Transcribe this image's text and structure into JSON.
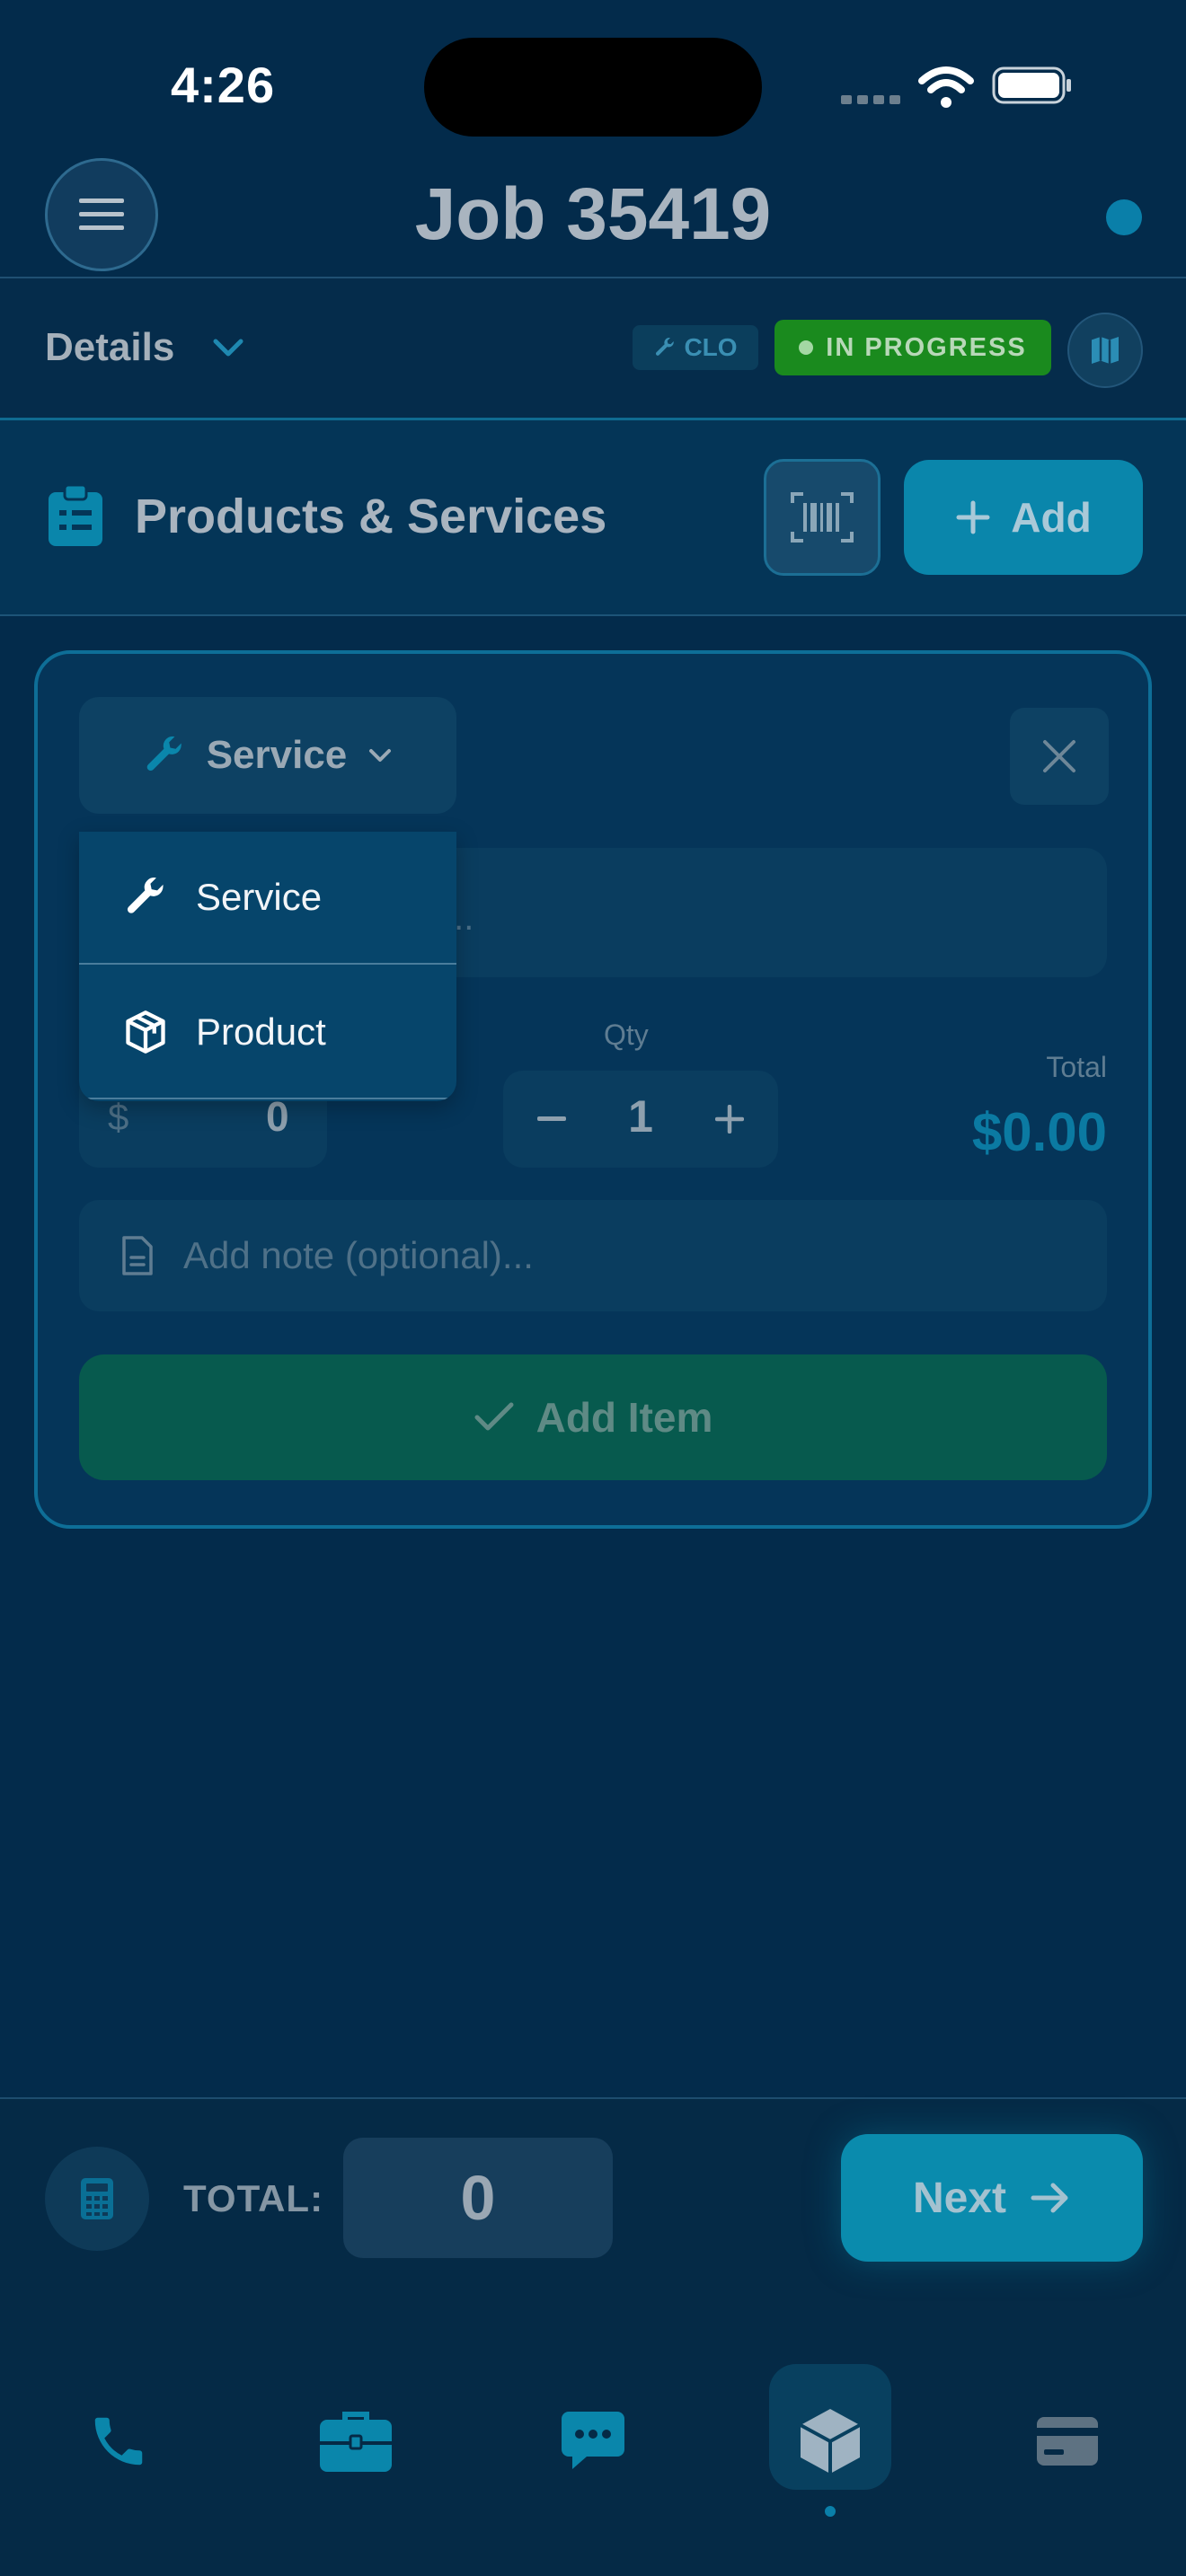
{
  "status_bar": {
    "time": "4:26"
  },
  "header": {
    "title": "Job 35419"
  },
  "details_bar": {
    "label": "Details",
    "trade_badge": "CLO",
    "status_badge": "IN PROGRESS"
  },
  "section": {
    "title": "Products & Services",
    "add_label": "Add"
  },
  "item_form": {
    "type_selected": "Service",
    "name_placeholder_tail": "...",
    "price_currency": "$",
    "price_value": "0",
    "qty_label": "Qty",
    "qty_value": "1",
    "total_label": "Total",
    "total_value": "$0.00",
    "note_placeholder": "Add note (optional)...",
    "add_item_label": "Add Item"
  },
  "dropdown": {
    "options": [
      {
        "label": "Service",
        "icon": "wrench-icon"
      },
      {
        "label": "Product",
        "icon": "box-icon"
      }
    ]
  },
  "footer": {
    "total_label": "TOTAL:",
    "total_value": "0",
    "next_label": "Next"
  },
  "tabbar": {
    "items": [
      {
        "icon": "phone-icon"
      },
      {
        "icon": "briefcase-icon"
      },
      {
        "icon": "chat-icon"
      },
      {
        "icon": "cube-icon",
        "active": true
      },
      {
        "icon": "card-icon"
      }
    ]
  },
  "colors": {
    "background": "#032b4b",
    "accent": "#0a86ab",
    "success": "#1a8a1e"
  }
}
